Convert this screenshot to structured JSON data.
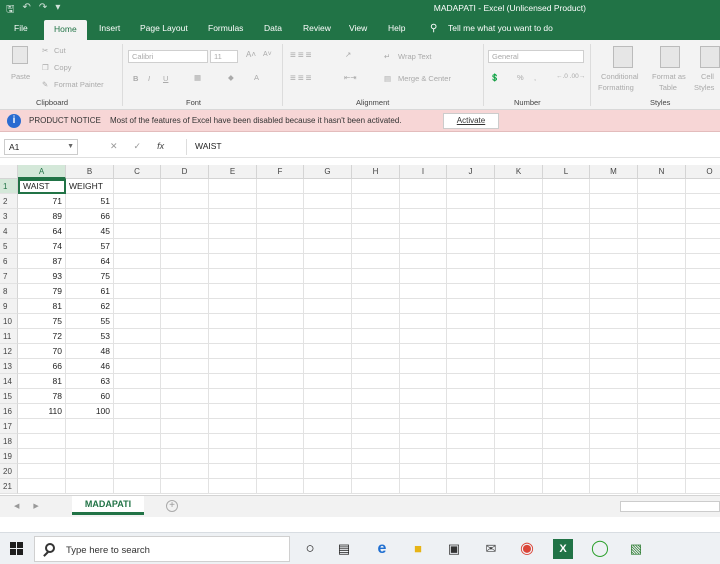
{
  "titlebar": {
    "title": "MADAPATI  -  Excel (Unlicensed Product)"
  },
  "tabs": [
    "File",
    "Home",
    "Insert",
    "Page Layout",
    "Formulas",
    "Data",
    "Review",
    "View",
    "Help"
  ],
  "tell_me": "Tell me what you want to do",
  "ribbon": {
    "clipboard": {
      "label": "Clipboard",
      "paste": "Paste",
      "cut": "Cut",
      "copy": "Copy",
      "format_painter": "Format Painter"
    },
    "font": {
      "label": "Font",
      "name": "Calibri",
      "size": "11",
      "bold": "B",
      "italic": "I",
      "underline": "U"
    },
    "alignment": {
      "label": "Alignment",
      "wrap_text": "Wrap Text",
      "merge_center": "Merge & Center"
    },
    "number": {
      "label": "Number",
      "format": "General",
      "percent": "%"
    },
    "styles": {
      "label": "Styles",
      "conditional": "Conditional",
      "formatting": "Formatting",
      "format_as": "Format as",
      "table": "Table",
      "cell": "Cell",
      "styles_btn": "Styles"
    }
  },
  "notice": {
    "title": "PRODUCT NOTICE",
    "message": "Most of the features of Excel have been disabled because it hasn't been activated.",
    "button": "Activate"
  },
  "formula_bar": {
    "name_box": "A1",
    "fx": "fx",
    "content": "WAIST"
  },
  "columns": [
    "A",
    "B",
    "C",
    "D",
    "E",
    "F",
    "G",
    "H",
    "I",
    "J",
    "K",
    "L",
    "M",
    "N",
    "O"
  ],
  "rows": [
    "1",
    "2",
    "3",
    "4",
    "5",
    "6",
    "7",
    "8",
    "9",
    "10",
    "11",
    "12",
    "13",
    "14",
    "15",
    "16",
    "17",
    "18",
    "19",
    "20",
    "21"
  ],
  "sheet": {
    "headers": [
      "WAIST",
      "WEIGHT"
    ],
    "data": [
      [
        71,
        51
      ],
      [
        89,
        66
      ],
      [
        64,
        45
      ],
      [
        74,
        57
      ],
      [
        87,
        64
      ],
      [
        93,
        75
      ],
      [
        79,
        61
      ],
      [
        81,
        62
      ],
      [
        75,
        55
      ],
      [
        72,
        53
      ],
      [
        70,
        48
      ],
      [
        66,
        46
      ],
      [
        81,
        63
      ],
      [
        78,
        60
      ],
      [
        110,
        100
      ]
    ]
  },
  "sheet_tab": "MADAPATI",
  "taskbar": {
    "search_placeholder": "Type here to search"
  }
}
